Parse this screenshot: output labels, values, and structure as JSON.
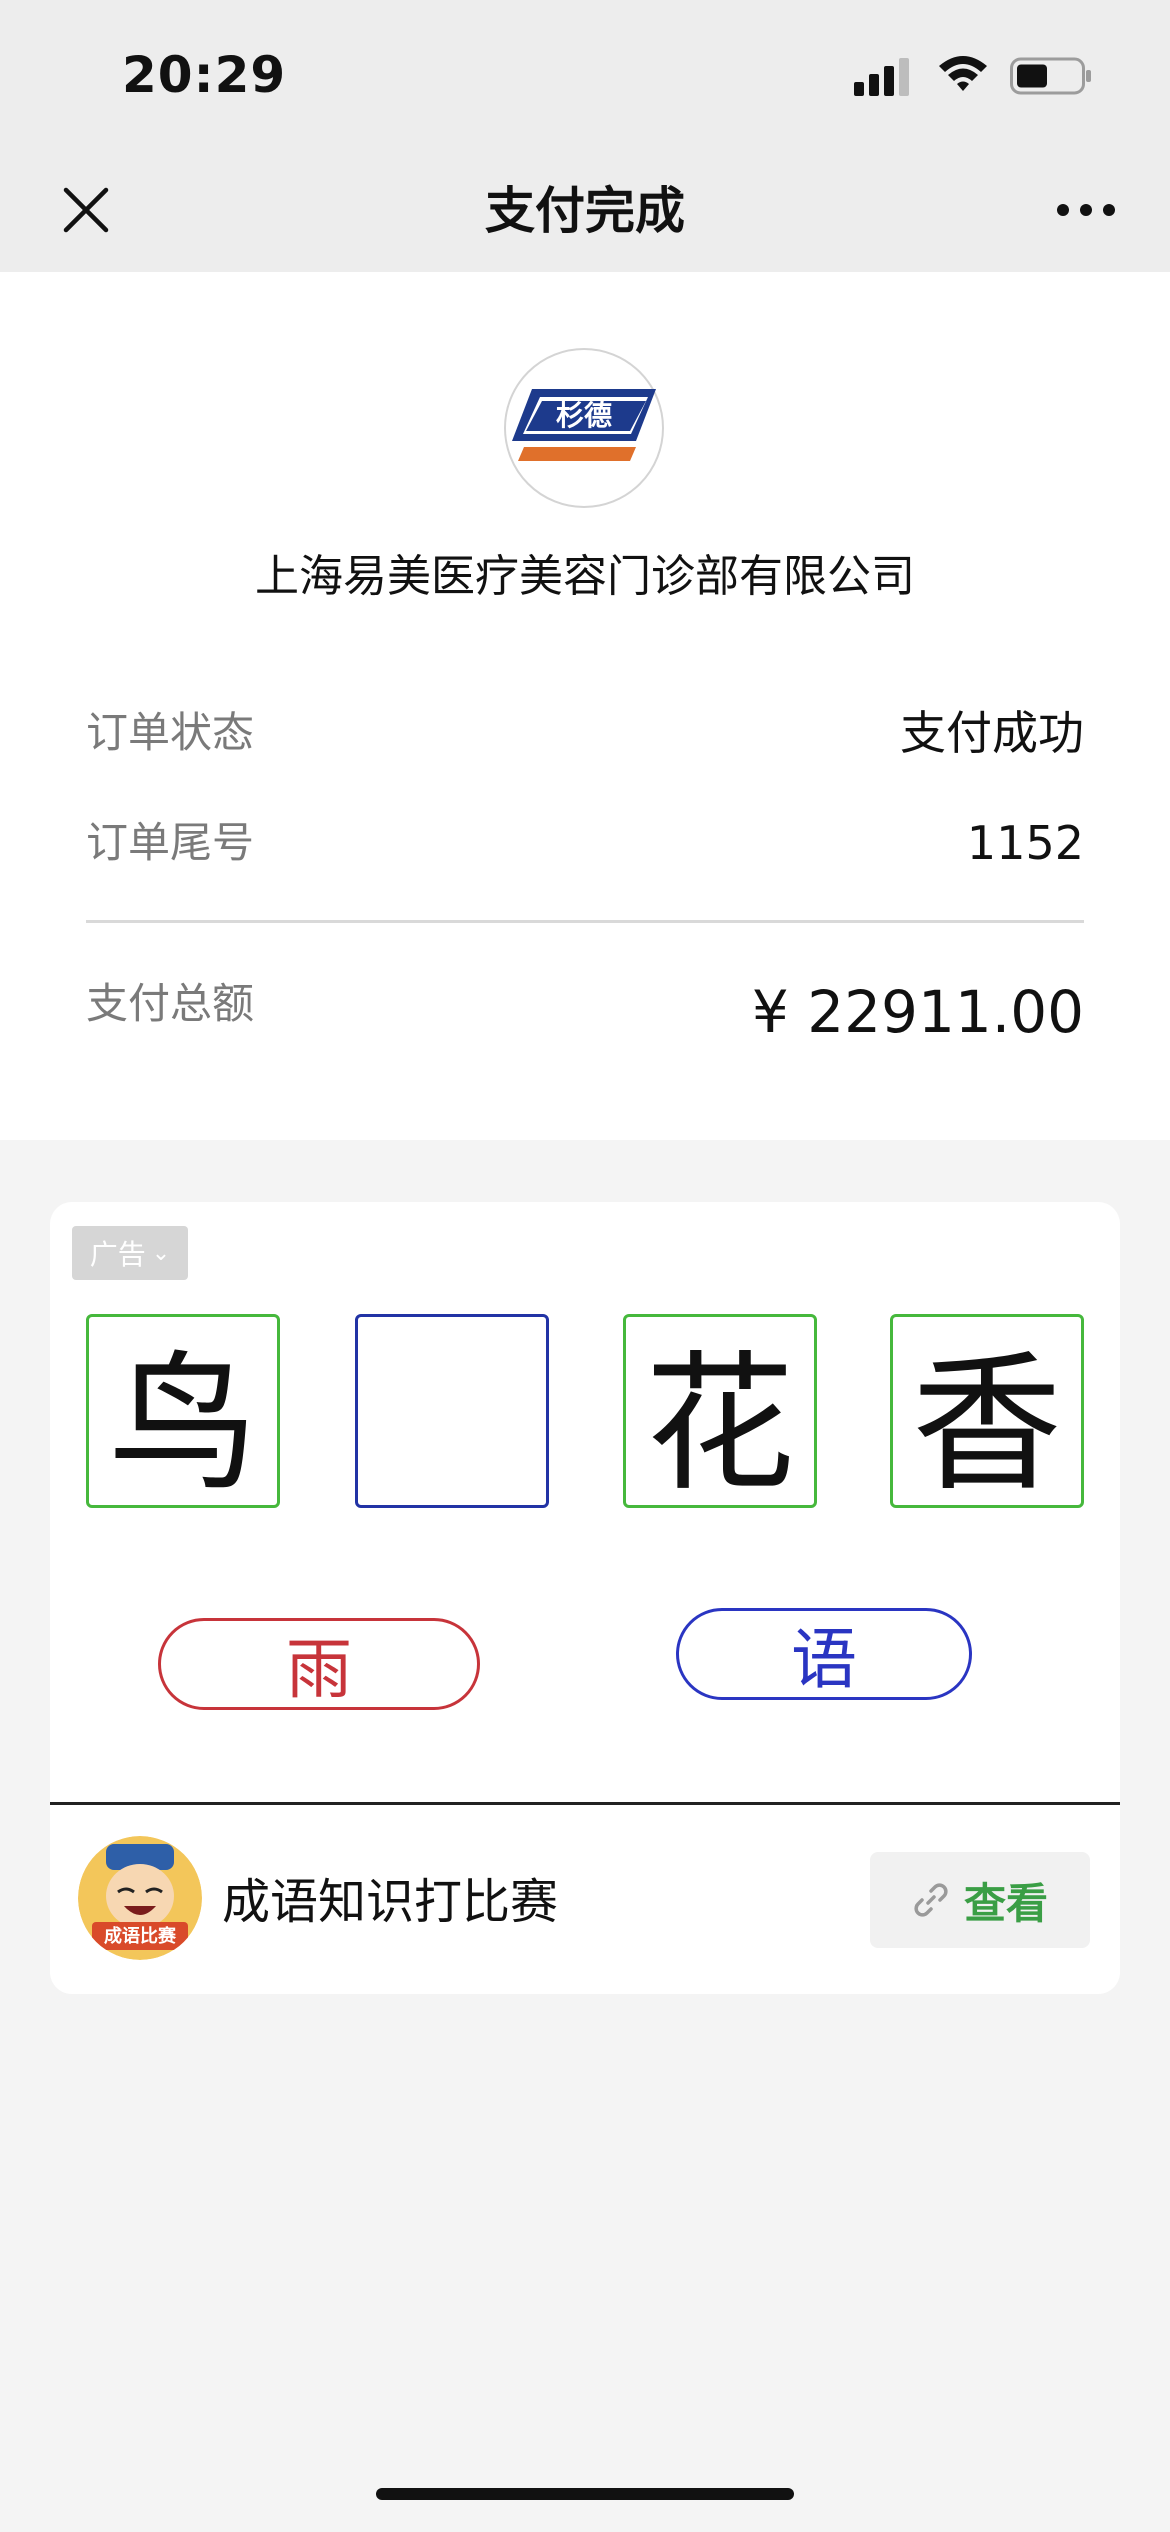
{
  "status_bar": {
    "time": "20:29"
  },
  "nav": {
    "title": "支付完成"
  },
  "merchant": {
    "logo_text": "杉德",
    "name": "上海易美医疗美容门诊部有限公司"
  },
  "order": {
    "status_label": "订单状态",
    "status_value": "支付成功",
    "tail_label": "订单尾号",
    "tail_value": "1152",
    "total_label": "支付总额",
    "total_value": "¥ 22911.00"
  },
  "ad": {
    "tag": "广告",
    "characters": [
      "鸟",
      "",
      "花",
      "香"
    ],
    "choices": [
      "雨",
      "语"
    ],
    "app_name": "成语知识打比赛",
    "app_badge_text": "成语比赛",
    "view_label": "查看"
  },
  "colors": {
    "correct_border": "#46b83c",
    "blank_border": "#2233a5",
    "choice_red": "#c7343a",
    "choice_blue": "#2a35c2",
    "view_green": "#3a9e45"
  }
}
